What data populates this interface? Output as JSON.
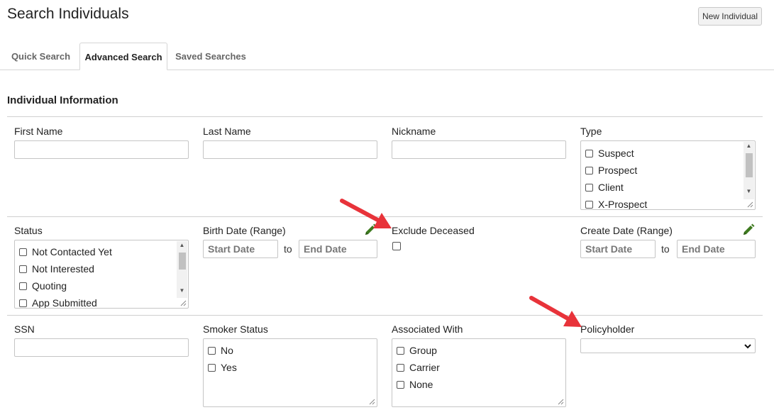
{
  "header": {
    "title": "Search Individuals",
    "new_button": "New Individual"
  },
  "tabs": [
    {
      "label": "Quick Search",
      "active": false
    },
    {
      "label": "Advanced Search",
      "active": true
    },
    {
      "label": "Saved Searches",
      "active": false
    }
  ],
  "section": {
    "title": "Individual Information"
  },
  "fields": {
    "first_name": {
      "label": "First Name",
      "value": ""
    },
    "last_name": {
      "label": "Last Name",
      "value": ""
    },
    "nickname": {
      "label": "Nickname",
      "value": ""
    },
    "type": {
      "label": "Type",
      "options": [
        "Suspect",
        "Prospect",
        "Client",
        "X-Prospect"
      ]
    },
    "status": {
      "label": "Status",
      "options": [
        "Not Contacted Yet",
        "Not Interested",
        "Quoting",
        "App Submitted"
      ]
    },
    "birth_date": {
      "label": "Birth Date (Range)",
      "start_placeholder": "Start Date",
      "end_placeholder": "End Date",
      "to": "to"
    },
    "exclude_deceased": {
      "label": "Exclude Deceased",
      "checked": false
    },
    "create_date": {
      "label": "Create Date (Range)",
      "start_placeholder": "Start Date",
      "end_placeholder": "End Date",
      "to": "to"
    },
    "ssn": {
      "label": "SSN",
      "value": ""
    },
    "smoker_status": {
      "label": "Smoker Status",
      "options": [
        "No",
        "Yes"
      ]
    },
    "associated_with": {
      "label": "Associated With",
      "options": [
        "Group",
        "Carrier",
        "None"
      ]
    },
    "policyholder": {
      "label": "Policyholder",
      "selected": ""
    }
  },
  "colors": {
    "annotation_arrow": "#e8333a",
    "pencil": "#3d7a1f",
    "tab_border": "#d5d5d5"
  },
  "icons": {
    "edit": "pencil-icon",
    "dropdown": "chevron-down-icon"
  }
}
